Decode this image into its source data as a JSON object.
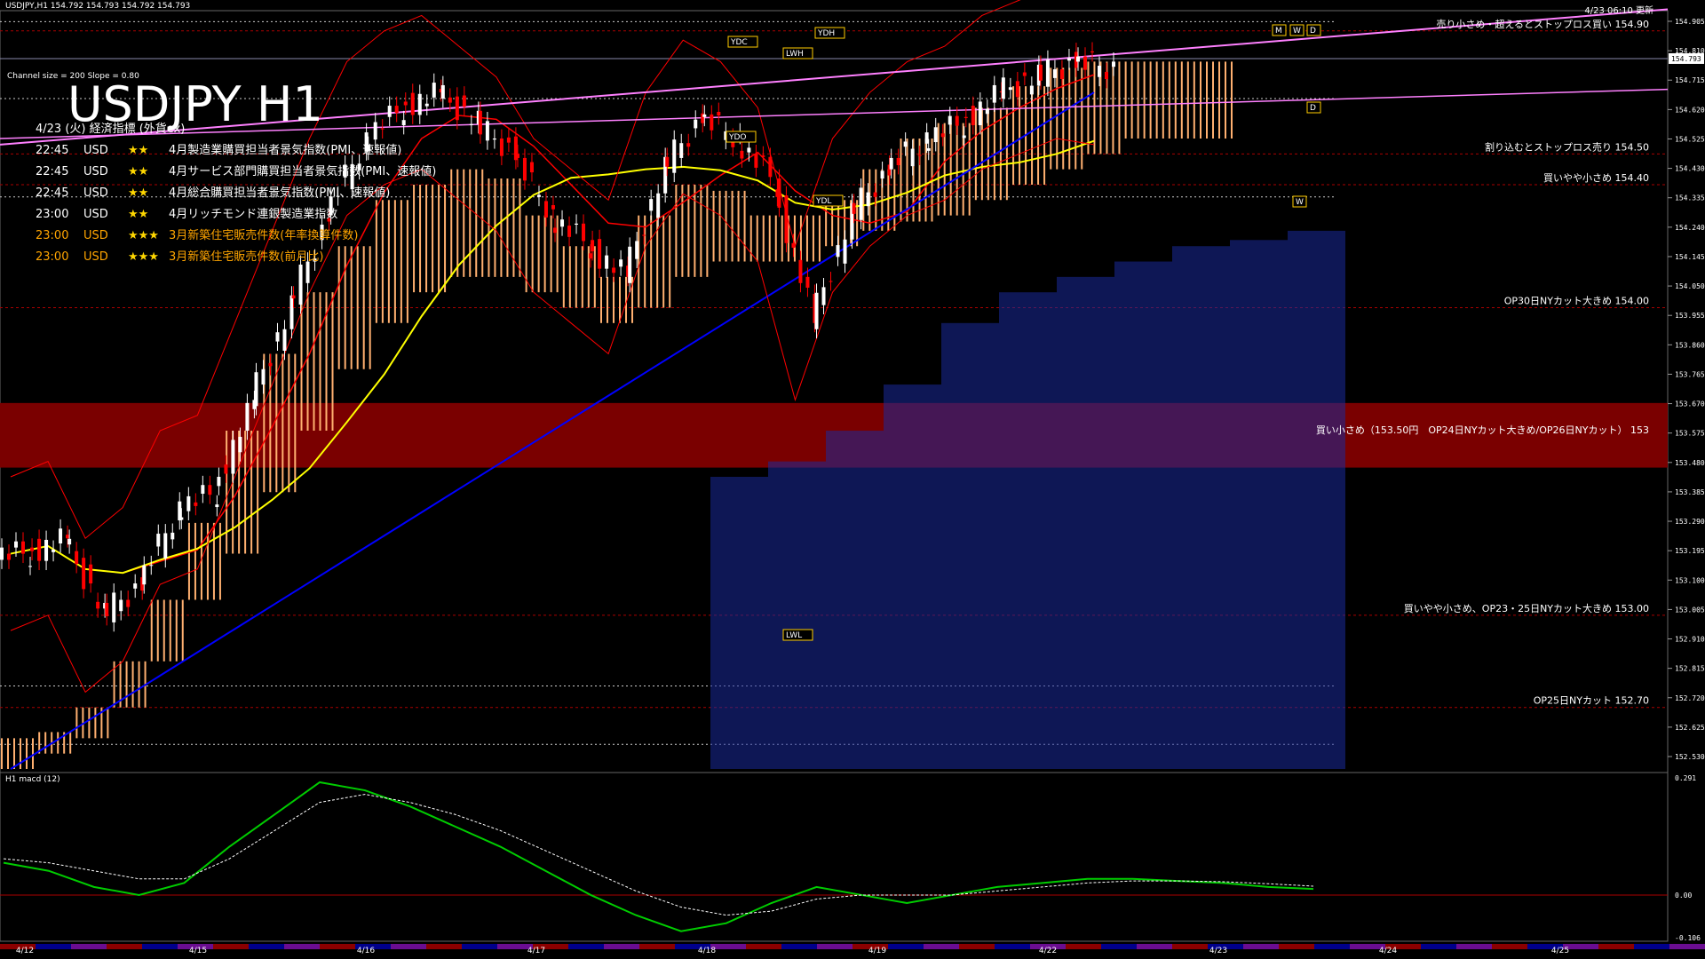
{
  "header": {
    "symbol_info": "USDJPY,H1  154.792 154.793 154.792 154.793",
    "chart_title": "USDJPY H1",
    "channel_info": "Channel size = 200 Slope = 0.80",
    "update_time": "4/23 06:10 更新"
  },
  "events": {
    "title": "4/23 (火) 経済指標 (外貨ex)",
    "items": [
      {
        "time": "22:45",
        "currency": "USD",
        "stars": "★★",
        "name": "4月製造業購買担当者景気指数(PMI、速報値)",
        "color": "#ffffff"
      },
      {
        "time": "22:45",
        "currency": "USD",
        "stars": "★★",
        "name": "4月サービス部門購買担当者景気指数(PMI、速報値)",
        "color": "#ffffff"
      },
      {
        "time": "22:45",
        "currency": "USD",
        "stars": "★★",
        "name": "4月総合購買担当者景気指数(PMI、速報値)",
        "color": "#ffffff"
      },
      {
        "time": "23:00",
        "currency": "USD",
        "stars": "★★",
        "name": "4月リッチモンド連銀製造業指数",
        "color": "#ffffff"
      },
      {
        "time": "23:00",
        "currency": "USD",
        "stars": "★★★",
        "name": "3月新築住宅販売件数(年率換算件数)",
        "color": "#ffa500"
      },
      {
        "time": "23:00",
        "currency": "USD",
        "stars": "★★★",
        "name": "3月新築住宅販売件数(前月比)",
        "color": "#ffa500"
      }
    ]
  },
  "annotations": [
    {
      "price": 154.9,
      "text": "売り小さめ・超えるとストップロス買い 154.90"
    },
    {
      "price": 154.5,
      "text": "割り込むとストップロス売り 154.50"
    },
    {
      "price": 154.4,
      "text": "買いやや小さめ 154.40"
    },
    {
      "price": 154.0,
      "text": "OP30日NYカット大きめ 154.00"
    },
    {
      "price": 153.58,
      "text": "買い小さめ（153.50円　OP24日NYカット大きめ/OP26日NYカット） 153"
    },
    {
      "price": 153.0,
      "text": "買いやや小さめ、OP23・25日NYカット大きめ 153.00"
    },
    {
      "price": 152.7,
      "text": "OP25日NYカット 152.70"
    }
  ],
  "markers": [
    "YDH",
    "YDC",
    "LWH",
    "YDO",
    "YDL",
    "LWL",
    "M",
    "W",
    "D",
    "D",
    "W"
  ],
  "indicator": {
    "label": "H1 macd (12)",
    "ticks": [
      "0.291",
      "0.00",
      "-0.106"
    ]
  },
  "price_axis": [
    "154.905",
    "154.810",
    "154.715",
    "154.620",
    "154.525",
    "154.430",
    "154.335",
    "154.240",
    "154.145",
    "154.050",
    "153.955",
    "153.860",
    "153.765",
    "153.670",
    "153.575",
    "153.480",
    "153.385",
    "153.290",
    "153.195",
    "153.100",
    "153.005",
    "152.910",
    "152.815",
    "152.720",
    "152.625",
    "152.530"
  ],
  "current_price": "154.793",
  "date_labels": [
    "4/12",
    "4/15",
    "4/16",
    "4/17",
    "4/18",
    "4/19",
    "4/22",
    "4/23",
    "4/24",
    "4/25"
  ],
  "colors": {
    "up": "#ffffff",
    "down": "#ff0000",
    "cloud_bull": "#ffb070",
    "cloud_bear": "#1a2a9a",
    "ma_fast": "#ff0000",
    "ma_mid": "#ffff00",
    "ma_slow": "#0000ff",
    "macd": "#00cc00",
    "signal": "#ffffff",
    "band": "#ff0000",
    "channel": "#ff80ff"
  },
  "chart_data": {
    "type": "candlestick",
    "title": "USDJPY H1",
    "ylim": [
      152.5,
      154.96
    ],
    "x": [
      "4/12",
      "4/15",
      "4/16",
      "4/17",
      "4/18",
      "4/19",
      "4/22",
      "4/23"
    ],
    "close": [
      153.2,
      153.25,
      153.0,
      153.1,
      153.35,
      153.4,
      153.7,
      154.0,
      154.3,
      154.55,
      154.65,
      154.7,
      154.6,
      154.5,
      154.3,
      154.2,
      154.1,
      154.45,
      154.62,
      154.55,
      154.4,
      153.95,
      154.3,
      154.45,
      154.55,
      154.6,
      154.7,
      154.75,
      154.8,
      154.78
    ],
    "series": [
      {
        "name": "macd",
        "values": [
          0.08,
          0.06,
          0.02,
          0.0,
          0.03,
          0.12,
          0.2,
          0.28,
          0.26,
          0.22,
          0.17,
          0.12,
          0.06,
          0.0,
          -0.05,
          -0.09,
          -0.07,
          -0.02,
          0.02,
          0.0,
          -0.02,
          0.0,
          0.02,
          0.03,
          0.04,
          0.04,
          0.035,
          0.03,
          0.02,
          0.015
        ]
      },
      {
        "name": "signal",
        "values": [
          0.09,
          0.08,
          0.06,
          0.04,
          0.04,
          0.09,
          0.16,
          0.23,
          0.25,
          0.23,
          0.2,
          0.16,
          0.11,
          0.06,
          0.01,
          -0.03,
          -0.05,
          -0.04,
          -0.01,
          0.0,
          0.0,
          0.0,
          0.01,
          0.02,
          0.03,
          0.035,
          0.035,
          0.033,
          0.028,
          0.022
        ]
      }
    ]
  }
}
